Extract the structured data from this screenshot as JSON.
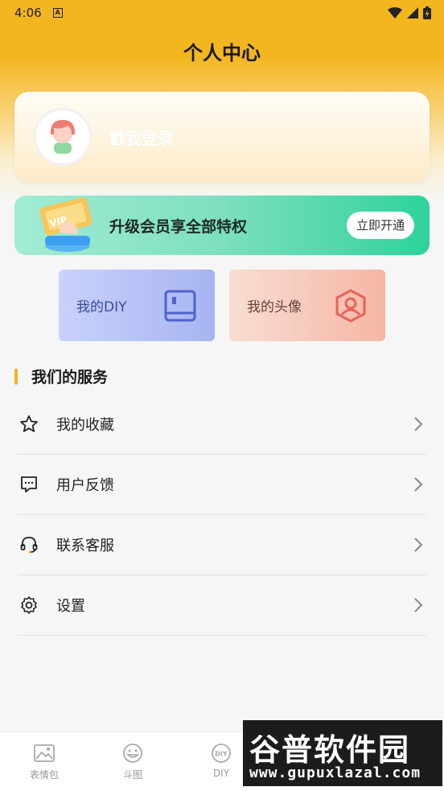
{
  "status_bar": {
    "time": "4:06",
    "notification_icon": "a-icon"
  },
  "header": {
    "title": "个人中心"
  },
  "login_card": {
    "label": "戳我登录"
  },
  "vip_banner": {
    "text": "升级会员享全部特权",
    "button_label": "立即开通",
    "art_text": "VIP"
  },
  "tiles": [
    {
      "label": "我的DIY",
      "icon": "book-icon"
    },
    {
      "label": "我的头像",
      "icon": "user-hexagon-icon"
    }
  ],
  "services": {
    "title": "我们的服务",
    "items": [
      {
        "label": "我的收藏",
        "icon": "star-icon"
      },
      {
        "label": "用户反馈",
        "icon": "chat-icon"
      },
      {
        "label": "联系客服",
        "icon": "headset-icon"
      },
      {
        "label": "设置",
        "icon": "gear-icon"
      }
    ]
  },
  "bottom_nav": {
    "items": [
      {
        "label": "表情包",
        "icon": "image-icon"
      },
      {
        "label": "斗图",
        "icon": "smile-icon"
      },
      {
        "label": "DIY",
        "icon": "diy-icon"
      }
    ]
  },
  "watermark": {
    "line1": "谷普软件园",
    "line2": "www.gupuxlazal.com"
  },
  "colors": {
    "header_yellow": "#f3b61f",
    "accent_bar": "#f4b31a",
    "vip_green": "#2ed39a"
  }
}
